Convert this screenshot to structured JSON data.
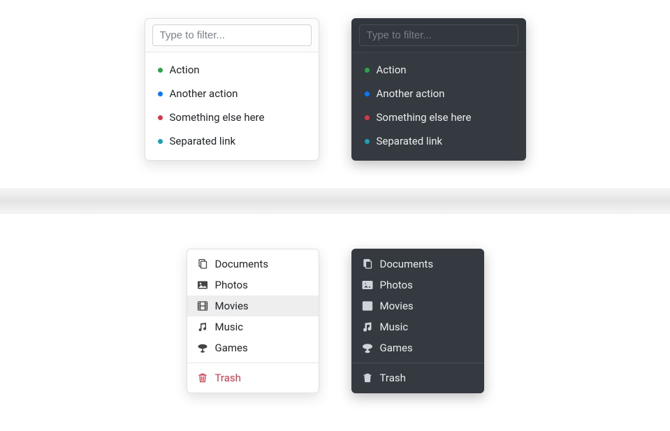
{
  "filter_menu": {
    "placeholder": "Type to filter...",
    "items": [
      {
        "label": "Action",
        "color": "#28a745"
      },
      {
        "label": "Another action",
        "color": "#007bff"
      },
      {
        "label": "Something else here",
        "color": "#dc3545"
      },
      {
        "label": "Separated link",
        "color": "#17a2b8"
      }
    ]
  },
  "icon_menu": {
    "items": [
      {
        "label": "Documents",
        "icon": "copy-icon"
      },
      {
        "label": "Photos",
        "icon": "image-icon"
      },
      {
        "label": "Movies",
        "icon": "film-icon"
      },
      {
        "label": "Music",
        "icon": "music-icon"
      },
      {
        "label": "Games",
        "icon": "gamepad-icon"
      }
    ],
    "footer": {
      "label": "Trash",
      "icon": "trash-icon"
    },
    "light_active_index": 2
  }
}
